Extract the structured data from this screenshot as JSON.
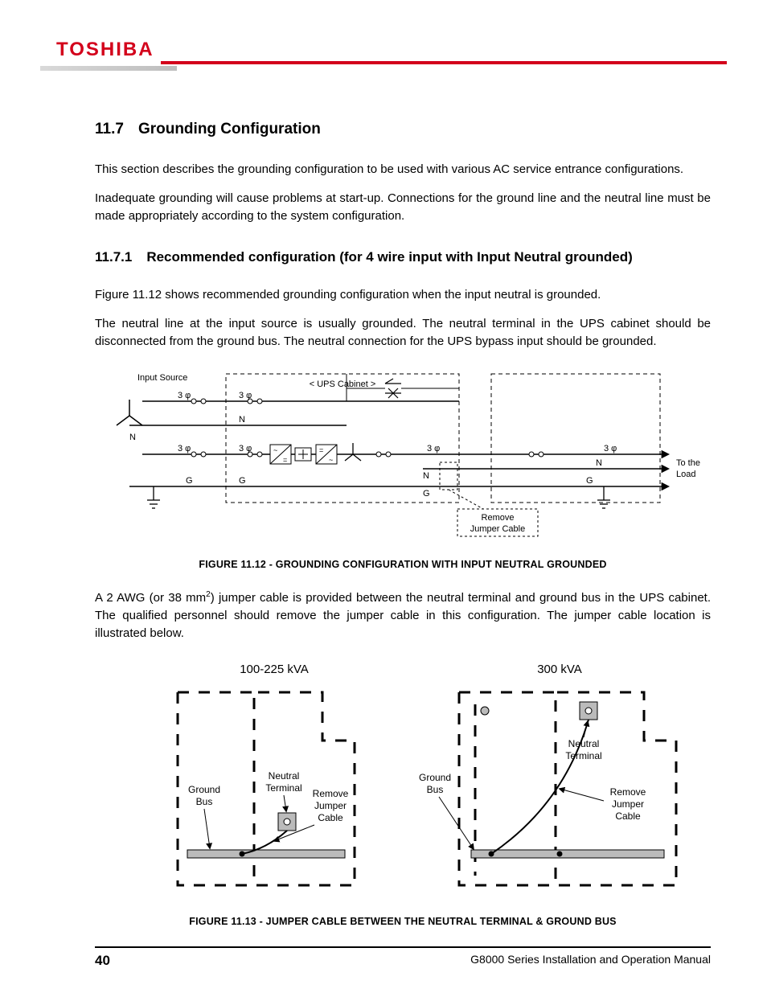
{
  "brand": "TOSHIBA",
  "section": {
    "num": "11.7",
    "title": "Grounding Configuration"
  },
  "p1": "This section describes the grounding configuration to be used with various AC service entrance configurations.",
  "p2": "Inadequate grounding will cause problems at start-up. Connections for the ground line and the neutral line must be made appropriately according to the system configuration.",
  "subsection": {
    "num": "11.7.1",
    "title": "Recommended configuration (for 4 wire input with Input Neutral grounded)"
  },
  "p3": "Figure 11.12 shows recommended grounding configuration when the input neutral is grounded.",
  "p4": "The neutral line at the input source is usually grounded. The neutral terminal in the UPS cabinet should be disconnected from the ground bus. The neutral connection for the UPS bypass input should be grounded.",
  "fig12": {
    "input_source": "Input Source",
    "ups_cabinet": "< UPS Cabinet >",
    "to_load": "To the Load",
    "remove": "Remove Jumper Cable",
    "labels": {
      "three_phase": "3 φ",
      "N": "N",
      "G": "G"
    },
    "caption": "FIGURE 11.12 - GROUNDING CONFIGURATION WITH INPUT NEUTRAL GROUNDED"
  },
  "p5a": "A 2 AWG (or 38 mm",
  "p5sup": "2",
  "p5b": ") jumper cable is provided between the neutral terminal and ground bus in the UPS cabinet. The qualified personnel should remove the jumper cable in this configuration. The jumper cable location is illustrated below.",
  "fig13": {
    "left_title": "100-225 kVA",
    "right_title": "300 kVA",
    "ground_bus": "Ground Bus",
    "neutral_term": "Neutral Terminal",
    "remove": "Remove Jumper Cable",
    "caption": "FIGURE 11.13 - JUMPER CABLE BETWEEN THE NEUTRAL TERMINAL & GROUND BUS"
  },
  "footer": {
    "page": "40",
    "doc": "G8000 Series Installation and Operation Manual"
  }
}
